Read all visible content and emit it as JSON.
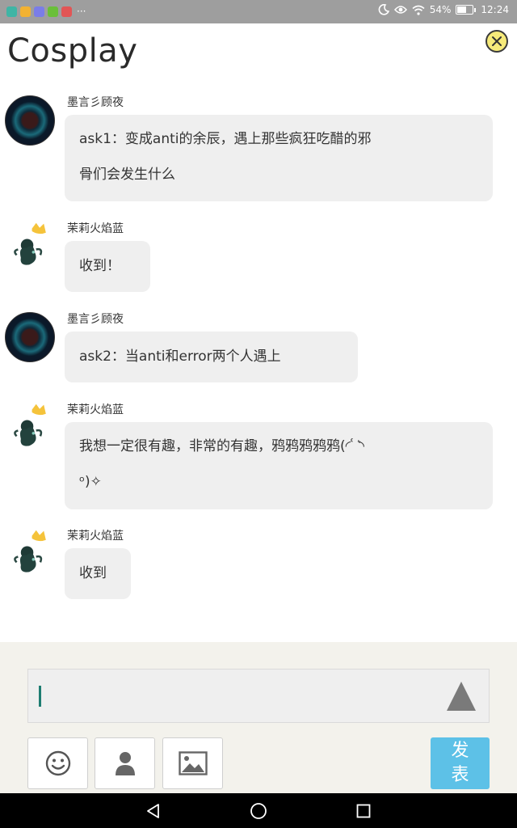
{
  "status_bar": {
    "battery_percent": "54%",
    "time": "12:24",
    "app_icon_colors": [
      "#3fb5a5",
      "#f2b233",
      "#7a7de8",
      "#6abf3a",
      "#e25555"
    ],
    "overflow": "···"
  },
  "header": {
    "title": "Cosplay",
    "close_icon": "close-icon"
  },
  "messages": [
    {
      "sender": "墨言彡顾夜",
      "avatar": "dark-circular-avatar",
      "lines": [
        "ask1：变成anti的余辰，遇上那些疯狂吃醋的邪",
        "骨们会发生什么"
      ]
    },
    {
      "sender": "茉莉火焰蓝",
      "avatar": "plant-avatar-with-crown",
      "lines": [
        "收到！"
      ]
    },
    {
      "sender": "墨言彡顾夜",
      "avatar": "dark-circular-avatar",
      "lines": [
        "ask2：当anti和error两个人遇上"
      ]
    },
    {
      "sender": "茉莉火焰蓝",
      "avatar": "plant-avatar-with-crown",
      "lines": [
        "我想一定很有趣，非常的有趣，鸦鸦鸦鸦鸦(◜ ͑ ͛◝",
        "ᵒ)✧"
      ]
    },
    {
      "sender": "茉莉火焰蓝",
      "avatar": "plant-avatar-with-crown",
      "lines": [
        "收到"
      ]
    }
  ],
  "composer": {
    "input_value": "",
    "send_icon": "triangle-send-icon",
    "tools": [
      "smiley-icon",
      "person-icon",
      "image-icon"
    ],
    "publish_label": "发表",
    "publish_color": "#5dc1e7"
  },
  "nav": {
    "icons": [
      "back-triangle-icon",
      "home-circle-icon",
      "recents-square-icon"
    ]
  }
}
